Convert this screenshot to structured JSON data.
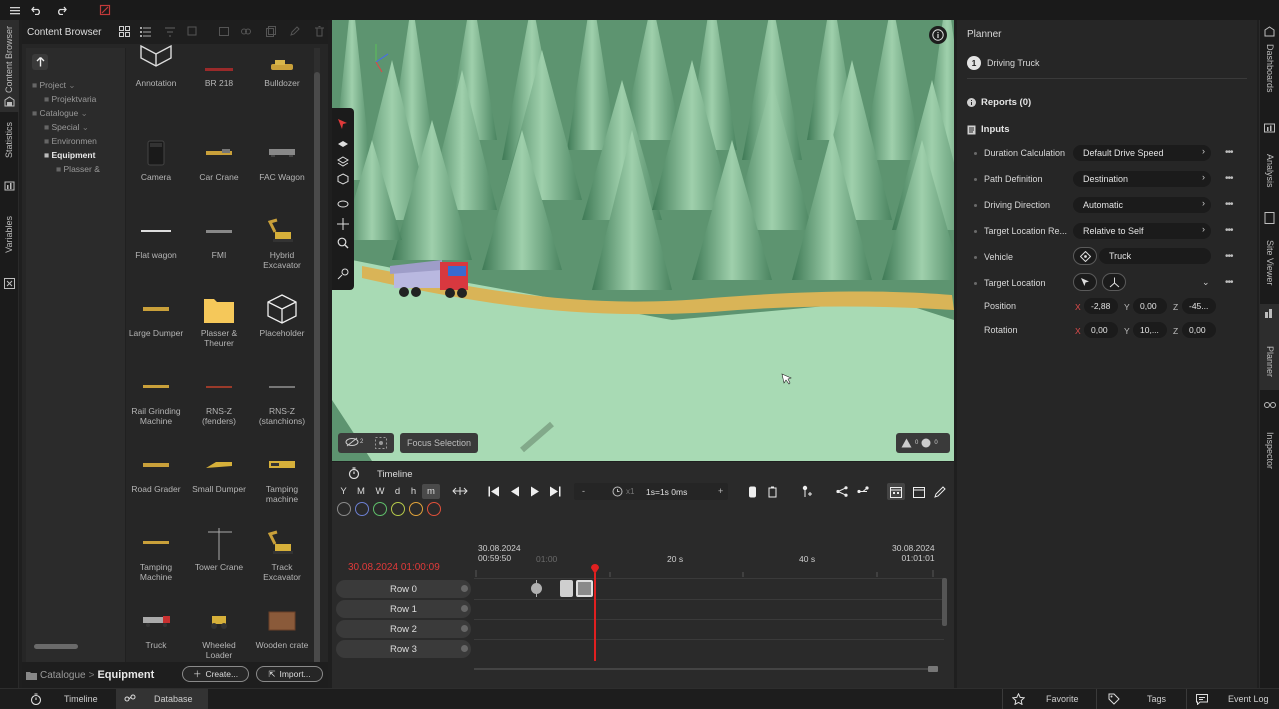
{
  "side_tabs_left": [
    "Content Browser",
    "Statistics",
    "Variables"
  ],
  "side_tabs_right": [
    "Dashboards",
    "Analysis",
    "Site Viewer",
    "Planner",
    "Inspector"
  ],
  "content_browser": {
    "title": "Content Browser",
    "tree": [
      {
        "label": "Project",
        "bold": false
      },
      {
        "label": "Projektvaria",
        "bold": false
      },
      {
        "label": "Catalogue",
        "bold": false
      },
      {
        "label": "Special",
        "bold": false
      },
      {
        "label": "Environmen",
        "bold": false
      },
      {
        "label": "Equipment",
        "bold": true
      },
      {
        "label": "Plasser &",
        "bold": false
      }
    ],
    "assets": [
      {
        "label": "Annotation",
        "icon": "annotation-box-icon"
      },
      {
        "label": "BR 218",
        "icon": "locomotive-icon"
      },
      {
        "label": "Bulldozer",
        "icon": "bulldozer-icon"
      },
      {
        "label": "Camera",
        "icon": "camera-icon"
      },
      {
        "label": "Car Crane",
        "icon": "car-crane-icon"
      },
      {
        "label": "FAC Wagon",
        "icon": "wagon-icon"
      },
      {
        "label": "Flat wagon",
        "icon": "flat-wagon-icon"
      },
      {
        "label": "FMI",
        "icon": "fmi-icon"
      },
      {
        "label": "Hybrid Excavator",
        "icon": "excavator-icon"
      },
      {
        "label": "Large Dumper",
        "icon": "dumper-icon"
      },
      {
        "label": "Plasser & Theurer",
        "icon": "folder-icon"
      },
      {
        "label": "Placeholder",
        "icon": "cube-icon"
      },
      {
        "label": "Rail Grinding Machine",
        "icon": "rail-machine-icon"
      },
      {
        "label": "RNS-Z (fenders)",
        "icon": "rail-machine-icon"
      },
      {
        "label": "RNS-Z (stanchions)",
        "icon": "rail-machine-icon"
      },
      {
        "label": "Road Grader",
        "icon": "grader-icon"
      },
      {
        "label": "Small Dumper",
        "icon": "dumper-icon"
      },
      {
        "label": "Tamping machine",
        "icon": "tamping-icon"
      },
      {
        "label": "Tamping Machine",
        "icon": "tamping-icon"
      },
      {
        "label": "Tower Crane",
        "icon": "tower-crane-icon"
      },
      {
        "label": "Track Excavator",
        "icon": "excavator-icon"
      },
      {
        "label": "Truck",
        "icon": "truck-icon"
      },
      {
        "label": "Wheeled Loader",
        "icon": "loader-icon"
      },
      {
        "label": "Wooden crate",
        "icon": "crate-icon"
      }
    ],
    "breadcrumb": {
      "parent": "Catalogue",
      "current": "Equipment"
    },
    "create_label": "Create...",
    "import_label": "Import..."
  },
  "viewport": {
    "focus_selection_label": "Focus Selection",
    "hidden_count": "2",
    "warnings_count": "0",
    "errors_count": "0"
  },
  "timeline": {
    "title": "Timeline",
    "scale_buttons": [
      "Y",
      "M",
      "W",
      "d",
      "h",
      "m"
    ],
    "active_scale": "m",
    "speed_label": "x1",
    "step_label": "1s=1s 0ms",
    "minus_label": "-",
    "plus_label": "+",
    "color_filters": [
      "#8a8a8a",
      "#6c7fd1",
      "#5fbf6a",
      "#b5c94a",
      "#e0a23a",
      "#e0503a"
    ],
    "current_time": "30.08.2024 01:00:09",
    "start_date": "30.08.2024",
    "start_time": "00:59:50",
    "tick_0100": "01:00",
    "tick_20s": "20 s",
    "tick_40s": "40 s",
    "end_date": "30.08.2024",
    "end_time": "01:01:01",
    "rows": [
      "Row 0",
      "Row 1",
      "Row 2",
      "Row 3"
    ]
  },
  "planner": {
    "title": "Planner",
    "step_number": "1",
    "step_label": "Driving Truck",
    "reports_label": "Reports (0)",
    "inputs_label": "Inputs",
    "fields": [
      {
        "label": "Duration Calculation",
        "value": "Default Drive Speed"
      },
      {
        "label": "Path Definition",
        "value": "Destination"
      },
      {
        "label": "Driving Direction",
        "value": "Automatic"
      },
      {
        "label": "Target Location Re...",
        "value": "Relative to Self"
      },
      {
        "label": "Vehicle",
        "value": "Truck"
      },
      {
        "label": "Target Location",
        "value": ""
      }
    ],
    "position": {
      "label": "Position",
      "x": "-2,88",
      "y": "0,00",
      "z": "-45..."
    },
    "rotation": {
      "label": "Rotation",
      "x": "0,00",
      "y": "10,...",
      "z": "0,00"
    },
    "axis_x": "X",
    "axis_y": "Y",
    "axis_z": "Z"
  },
  "bottom_bar": {
    "timeline_tab": "Timeline",
    "database_tab": "Database",
    "favorite": "Favorite",
    "tags": "Tags",
    "event_log": "Event Log"
  }
}
